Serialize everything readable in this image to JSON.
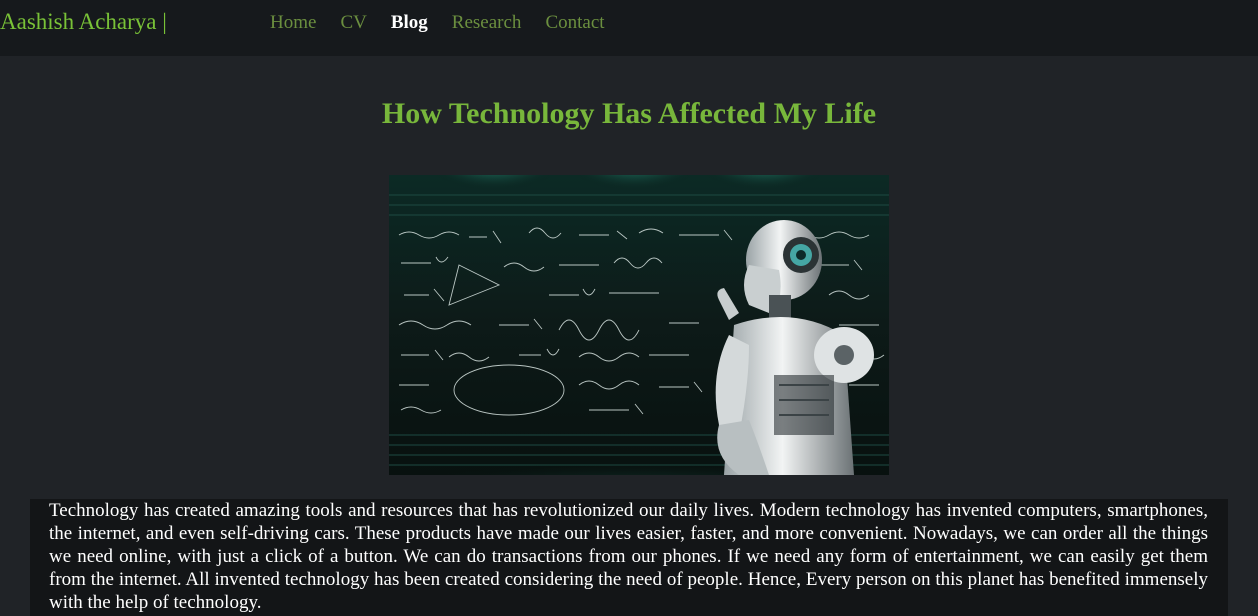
{
  "nav": {
    "brand": "Aashish Acharya |",
    "links": [
      {
        "label": "Home",
        "active": false
      },
      {
        "label": "CV",
        "active": false
      },
      {
        "label": "Blog",
        "active": true
      },
      {
        "label": "Research",
        "active": false
      },
      {
        "label": "Contact",
        "active": false
      }
    ]
  },
  "article": {
    "title": "How Technology Has Affected My Life",
    "image_alt_icon": "robot-chalkboard-image",
    "body": "Technology has created amazing tools and resources that has revolutionized our daily lives. Modern technology has invented computers, smartphones, the internet, and even self-driving cars. These products have made our lives easier, faster, and more convenient. Nowadays, we can order all the things we need online, with just a click of a button. We can do transactions from our phones. If we need any form of entertainment, we can easily get them from the internet. All invented technology has been created considering the need of people. Hence, Every person on this planet has benefited immensely with the help of technology."
  },
  "colors": {
    "accent": "#79c237",
    "background": "#202327",
    "navbar": "#16191c",
    "nav_link": "#6b8f3f"
  }
}
